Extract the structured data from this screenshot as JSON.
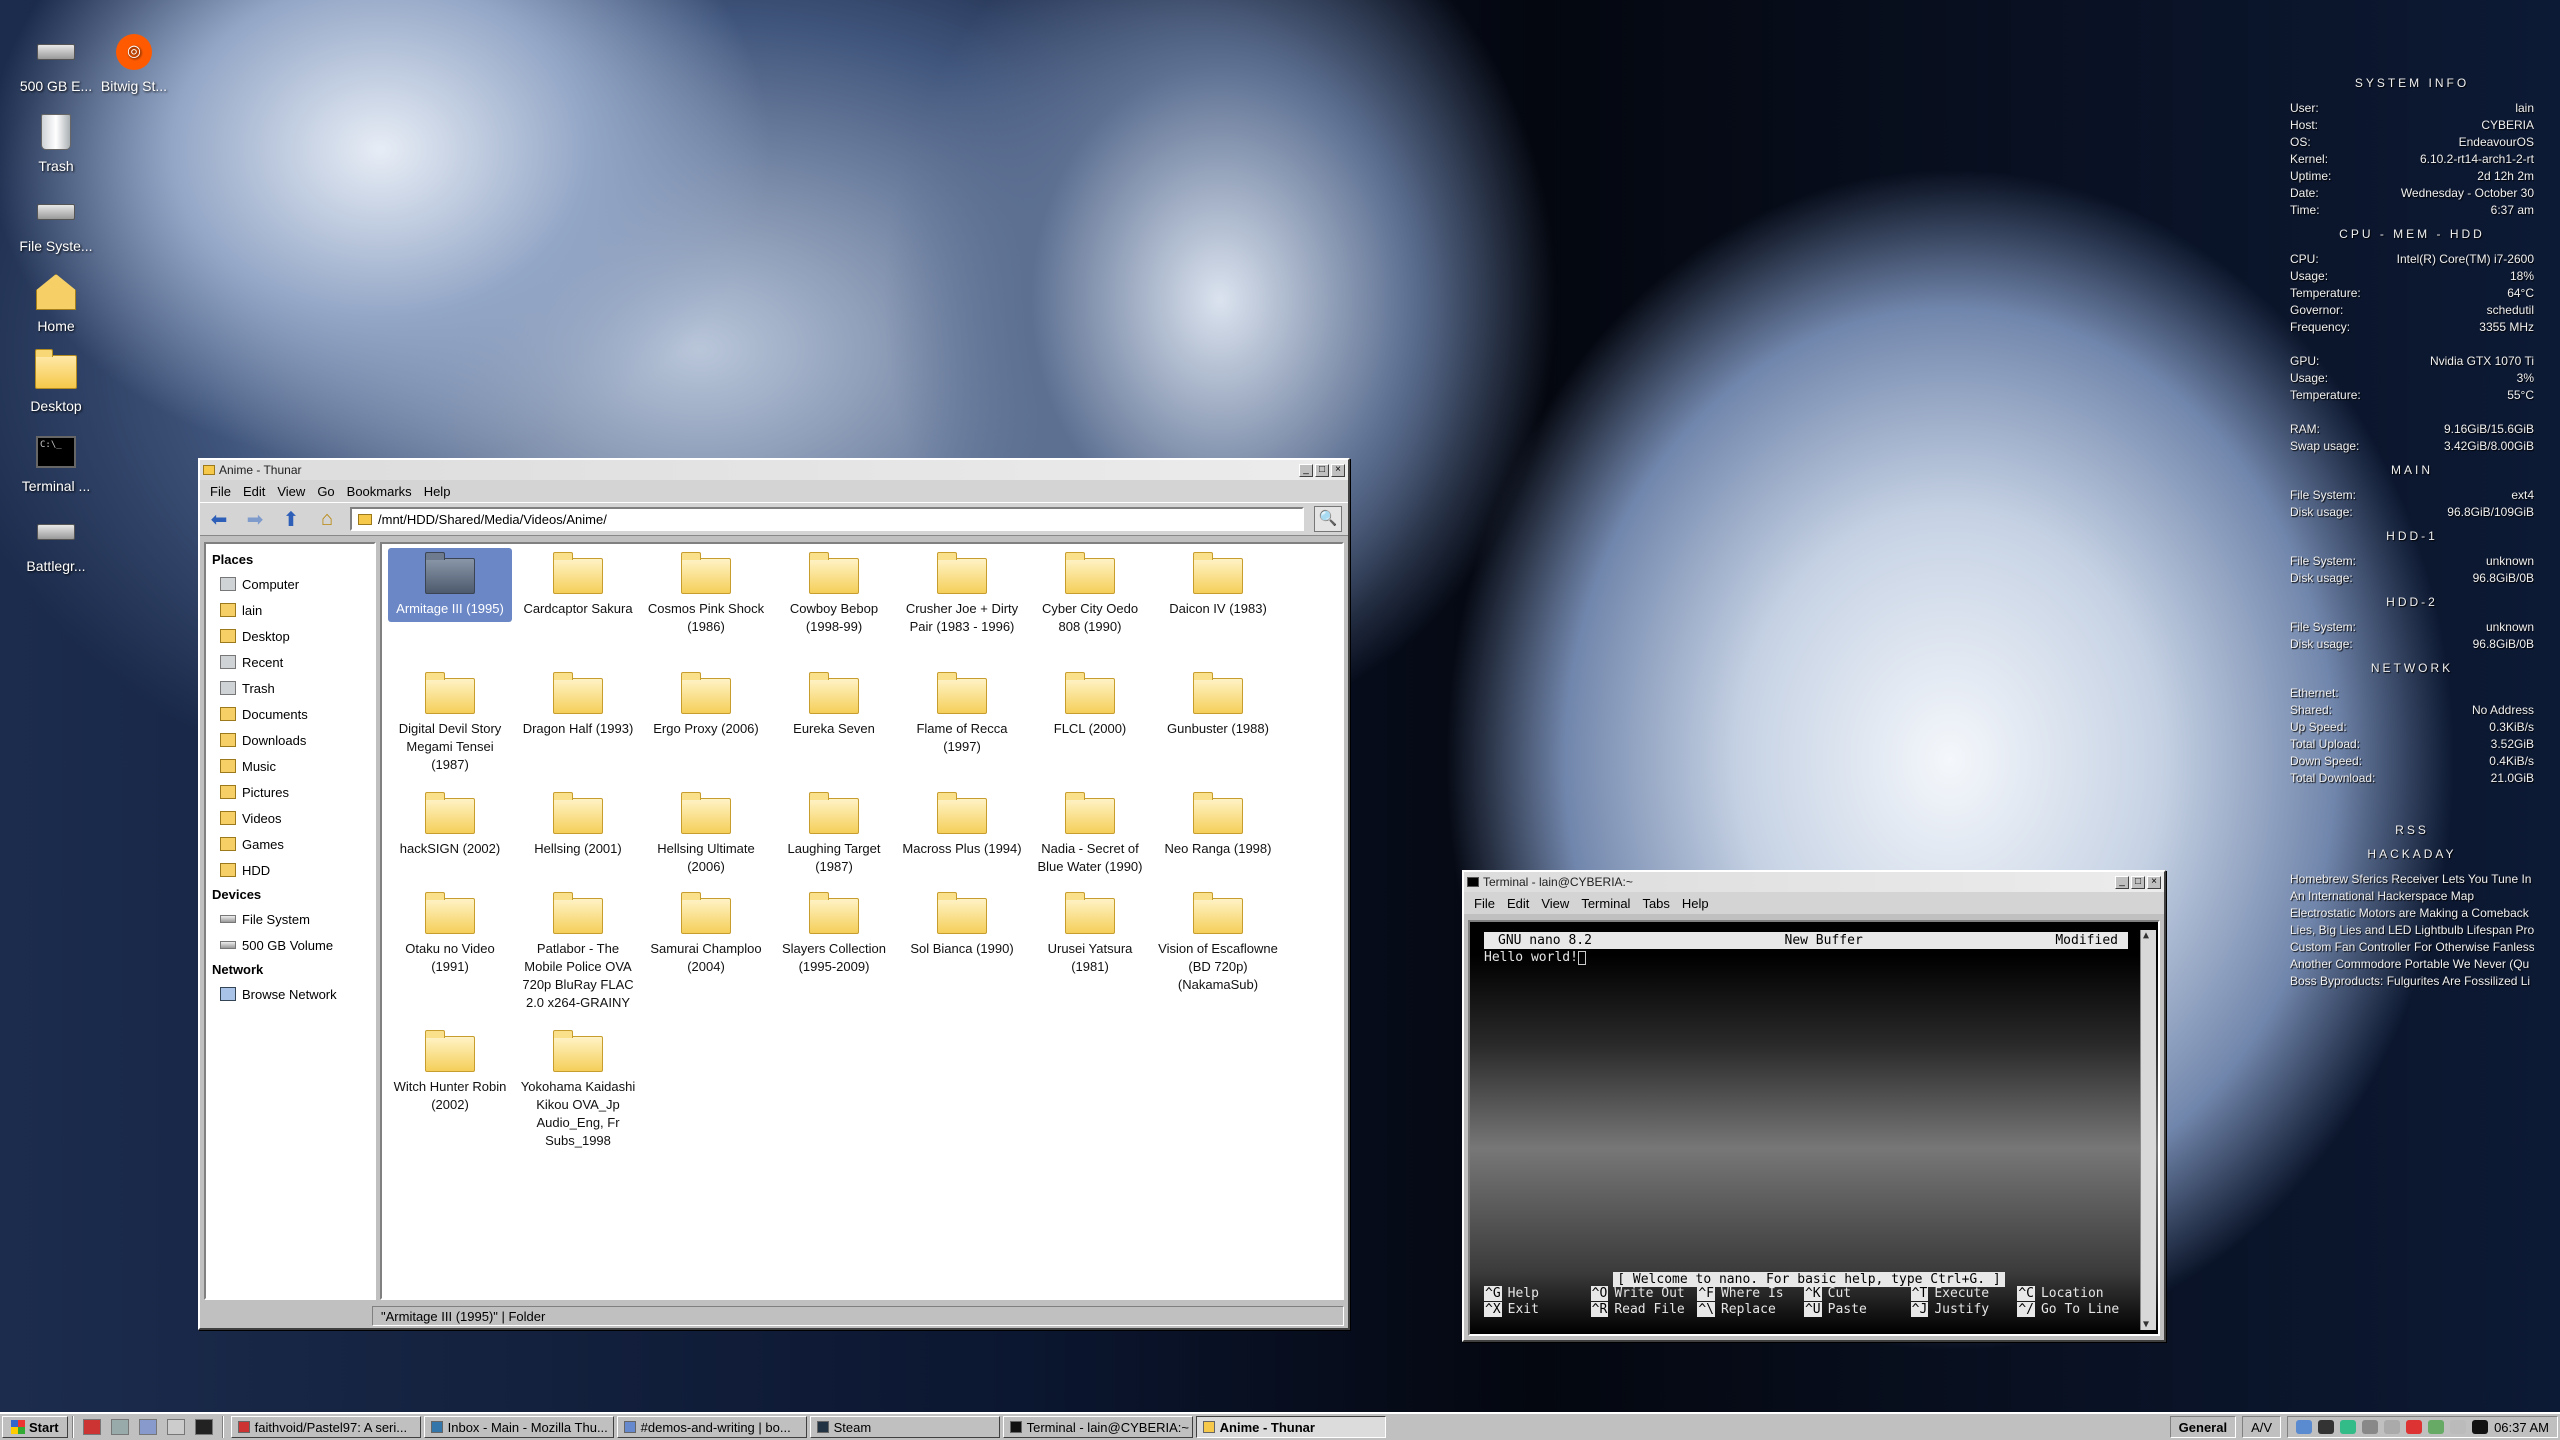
{
  "desktop": {
    "icons": [
      {
        "label": "500 GB E...",
        "icon": "drive-icon"
      },
      {
        "label": "Bitwig St...",
        "icon": "bitwig-icon"
      },
      {
        "label": "Trash",
        "icon": "trash-icon"
      },
      {
        "label": "File Syste...",
        "icon": "drive-icon"
      },
      {
        "label": "Home",
        "icon": "home-folder-icon"
      },
      {
        "label": "Desktop",
        "icon": "folder-icon"
      },
      {
        "label": "Terminal ...",
        "icon": "terminal-icon"
      },
      {
        "label": "Battlegr...",
        "icon": "drive-icon"
      }
    ]
  },
  "thunar": {
    "title": "Anime - Thunar",
    "menu": [
      "File",
      "Edit",
      "View",
      "Go",
      "Bookmarks",
      "Help"
    ],
    "location": "/mnt/HDD/Shared/Media/Videos/Anime/",
    "sidebar": {
      "places_header": "Places",
      "places": [
        "Computer",
        "lain",
        "Desktop",
        "Recent",
        "Trash",
        "Documents",
        "Downloads",
        "Music",
        "Pictures",
        "Videos",
        "Games",
        "HDD"
      ],
      "devices_header": "Devices",
      "devices": [
        "File System",
        "500 GB Volume"
      ],
      "network_header": "Network",
      "network": [
        "Browse Network"
      ]
    },
    "files": [
      "Armitage III (1995)",
      "Cardcaptor Sakura",
      "Cosmos Pink Shock (1986)",
      "Cowboy Bebop (1998-99)",
      "Crusher Joe + Dirty Pair (1983 - 1996)",
      "Cyber City Oedo 808 (1990)",
      "Daicon IV (1983)",
      "Digital Devil Story Megami Tensei (1987)",
      "Dragon Half (1993)",
      "Ergo Proxy (2006)",
      "Eureka Seven",
      "Flame of Recca (1997)",
      "FLCL (2000)",
      "Gunbuster (1988)",
      "hackSIGN (2002)",
      "Hellsing (2001)",
      "Hellsing Ultimate (2006)",
      "Laughing Target (1987)",
      "Macross Plus (1994)",
      "Nadia - Secret of Blue Water (1990)",
      "Neo Ranga (1998)",
      "Otaku no Video (1991)",
      "Patlabor - The Mobile Police OVA 720p BluRay FLAC 2.0 x264-GRAINY",
      "Samurai Champloo (2004)",
      "Slayers Collection (1995-2009)",
      "Sol Bianca (1990)",
      "Urusei Yatsura (1981)",
      "Vision of Escaflowne (BD 720p) (NakamaSub)",
      "Witch Hunter Robin (2002)",
      "Yokohama Kaidashi Kikou OVA_Jp Audio_Eng, Fr Subs_1998"
    ],
    "selected_file": "Armitage III (1995)",
    "status": "\"Armitage III (1995)\"  |  Folder"
  },
  "terminal": {
    "title": "Terminal - lain@CYBERIA:~",
    "menu": [
      "File",
      "Edit",
      "View",
      "Terminal",
      "Tabs",
      "Help"
    ],
    "nano": {
      "version": "GNU nano 8.2",
      "buffer": "New Buffer",
      "state": "Modified",
      "content": "Hello world!",
      "message": "[ Welcome to nano.  For basic help, type Ctrl+G. ]",
      "shortcuts": [
        {
          "key": "^G",
          "label": "Help"
        },
        {
          "key": "^O",
          "label": "Write Out"
        },
        {
          "key": "^F",
          "label": "Where Is"
        },
        {
          "key": "^K",
          "label": "Cut"
        },
        {
          "key": "^T",
          "label": "Execute"
        },
        {
          "key": "^C",
          "label": "Location"
        },
        {
          "key": "^X",
          "label": "Exit"
        },
        {
          "key": "^R",
          "label": "Read File"
        },
        {
          "key": "^\\",
          "label": "Replace"
        },
        {
          "key": "^U",
          "label": "Paste"
        },
        {
          "key": "^J",
          "label": "Justify"
        },
        {
          "key": "^/",
          "label": "Go To Line"
        }
      ]
    }
  },
  "conky": {
    "system_header": "SYSTEM INFO",
    "system": [
      {
        "k": "User:",
        "v": "lain"
      },
      {
        "k": "Host:",
        "v": "CYBERIA"
      },
      {
        "k": "OS:",
        "v": "EndeavourOS"
      },
      {
        "k": "Kernel:",
        "v": "6.10.2-rt14-arch1-2-rt"
      },
      {
        "k": "Uptime:",
        "v": "2d 12h 2m"
      },
      {
        "k": "Date:",
        "v": "Wednesday - October 30"
      },
      {
        "k": "Time:",
        "v": "6:37 am"
      }
    ],
    "cpu_header": "CPU - MEM - HDD",
    "cpu": [
      {
        "k": "CPU:",
        "v": "Intel(R) Core(TM) i7-2600"
      },
      {
        "k": "Usage:",
        "v": "18%"
      },
      {
        "k": "Temperature:",
        "v": "64°C"
      },
      {
        "k": "Governor:",
        "v": "schedutil"
      },
      {
        "k": "Frequency:",
        "v": "3355 MHz"
      }
    ],
    "gpu": [
      {
        "k": "GPU:",
        "v": "Nvidia GTX 1070 Ti"
      },
      {
        "k": "Usage:",
        "v": "3%"
      },
      {
        "k": "Temperature:",
        "v": "55°C"
      }
    ],
    "mem": [
      {
        "k": "RAM:",
        "v": "9.16GiB/15.6GiB"
      },
      {
        "k": "Swap usage:",
        "v": "3.42GiB/8.00GiB"
      }
    ],
    "main_header": "MAIN",
    "main": [
      {
        "k": "File System:",
        "v": "ext4"
      },
      {
        "k": "Disk usage:",
        "v": "96.8GiB/109GiB"
      }
    ],
    "hdd1_header": "HDD-1",
    "hdd1": [
      {
        "k": "File System:",
        "v": "unknown"
      },
      {
        "k": "Disk usage:",
        "v": "96.8GiB/0B"
      }
    ],
    "hdd2_header": "HDD-2",
    "hdd2": [
      {
        "k": "File System:",
        "v": "unknown"
      },
      {
        "k": "Disk usage:",
        "v": "96.8GiB/0B"
      }
    ],
    "network_header": "NETWORK",
    "network": [
      {
        "k": "Ethernet:",
        "v": ""
      },
      {
        "k": "Shared:",
        "v": "No Address"
      },
      {
        "k": "Up Speed:",
        "v": "0.3KiB/s"
      },
      {
        "k": "Total Upload:",
        "v": "3.52GiB"
      },
      {
        "k": "Down Speed:",
        "v": "0.4KiB/s"
      },
      {
        "k": "Total Download:",
        "v": "21.0GiB"
      }
    ],
    "rss_header": "RSS",
    "hackaday_header": "HACKADAY",
    "news": [
      "Homebrew Sferics Receiver Lets You Tune In",
      "An International Hackerspace Map",
      "Electrostatic Motors are Making a Comeback",
      "Lies, Big Lies and LED Lightbulb Lifespan Pro",
      "Custom Fan Controller For Otherwise Fanless",
      "Another Commodore Portable We Never (Qu",
      "Boss Byproducts: Fulgurites Are Fossilized Li"
    ]
  },
  "taskbar": {
    "start": "Start",
    "tasks": [
      "faithvoid/Pastel97: A seri...",
      "Inbox - Main - Mozilla Thu...",
      "#demos-and-writing | bo...",
      "Steam",
      "Terminal - lain@CYBERIA:~",
      "Anime - Thunar"
    ],
    "active_task": "Anime - Thunar",
    "keyboard_layout": "General",
    "volume_label": "A/V",
    "clock": "06:37 AM"
  }
}
